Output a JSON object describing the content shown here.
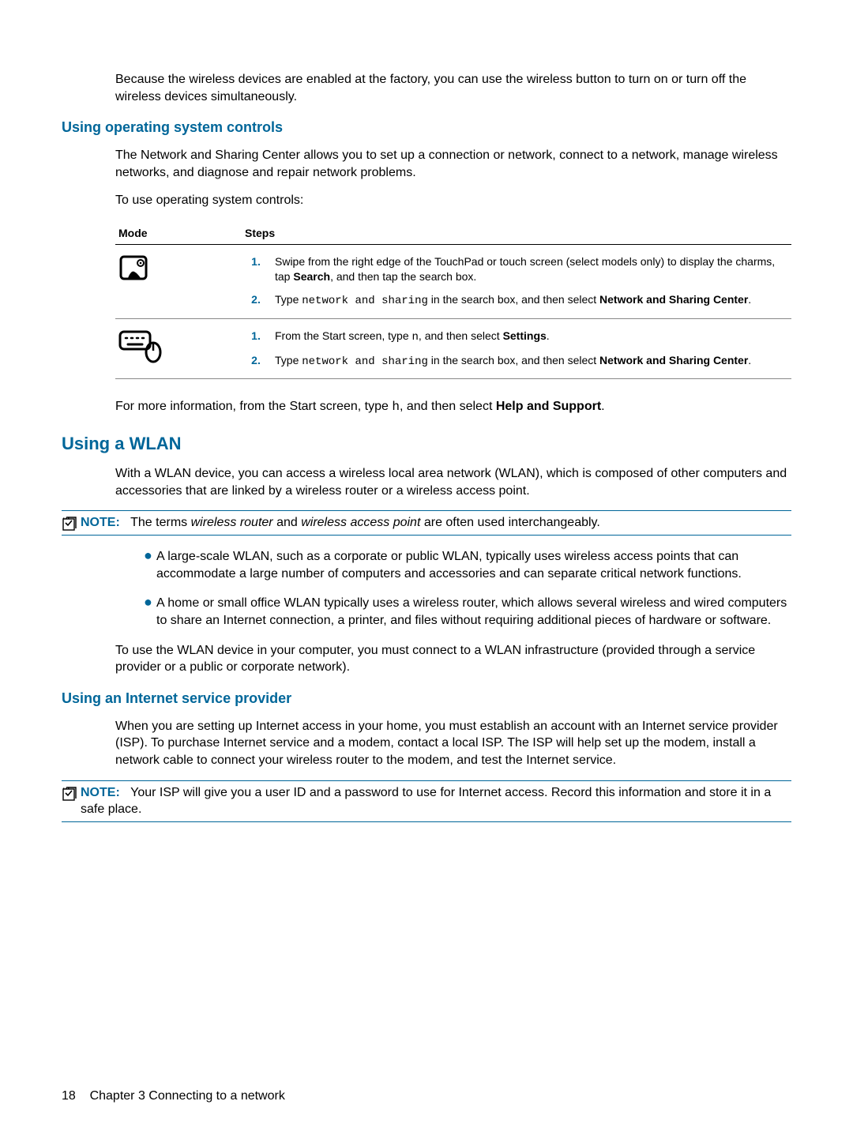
{
  "intro_para": "Because the wireless devices are enabled at the factory, you can use the wireless button to turn on or turn off the wireless devices simultaneously.",
  "section_os": {
    "heading": "Using operating system controls",
    "para1": "The Network and Sharing Center allows you to set up a connection or network, connect to a network, manage wireless networks, and diagnose and repair network problems.",
    "para2": "To use operating system controls:",
    "th_mode": "Mode",
    "th_steps": "Steps",
    "row1": {
      "s1_pre": "Swipe from the right edge of the TouchPad or touch screen (select models only) to display the charms, tap ",
      "s1_bold": "Search",
      "s1_post": ", and then tap the search box.",
      "s2_pre": "Type ",
      "s2_code": "network and sharing",
      "s2_mid": " in the search box, and then select ",
      "s2_bold": "Network and Sharing Center",
      "s2_post": "."
    },
    "row2": {
      "s1_pre": "From the Start screen, type ",
      "s1_code": "n",
      "s1_mid": ", and then select ",
      "s1_bold": "Settings",
      "s1_post": ".",
      "s2_pre": "Type ",
      "s2_code": "network and sharing",
      "s2_mid": " in the search box, and then select ",
      "s2_bold": "Network and Sharing Center",
      "s2_post": "."
    },
    "after_table_pre": "For more information, from the Start screen, type ",
    "after_table_code": "h",
    "after_table_mid": ", and then select ",
    "after_table_bold": "Help and Support",
    "after_table_post": "."
  },
  "section_wlan": {
    "heading": "Using a WLAN",
    "para1": "With a WLAN device, you can access a wireless local area network (WLAN), which is composed of other computers and accessories that are linked by a wireless router or a wireless access point.",
    "note_label": "NOTE:",
    "note_pre": "The terms ",
    "note_i1": "wireless router",
    "note_mid": " and ",
    "note_i2": "wireless access point",
    "note_post": " are often used interchangeably.",
    "bullet1": "A large-scale WLAN, such as a corporate or public WLAN, typically uses wireless access points that can accommodate a large number of computers and accessories and can separate critical network functions.",
    "bullet2": "A home or small office WLAN typically uses a wireless router, which allows several wireless and wired computers to share an Internet connection, a printer, and files without requiring additional pieces of hardware or software.",
    "para2": "To use the WLAN device in your computer, you must connect to a WLAN infrastructure (provided through a service provider or a public or corporate network)."
  },
  "section_isp": {
    "heading": "Using an Internet service provider",
    "para1": "When you are setting up Internet access in your home, you must establish an account with an Internet service provider (ISP). To purchase Internet service and a modem, contact a local ISP. The ISP will help set up the modem, install a network cable to connect your wireless router to the modem, and test the Internet service.",
    "note_label": "NOTE:",
    "note_text": "Your ISP will give you a user ID and a password to use for Internet access. Record this information and store it in a safe place."
  },
  "footer": {
    "page": "18",
    "chapter": "Chapter 3   Connecting to a network"
  },
  "numbers": {
    "n1": "1.",
    "n2": "2."
  }
}
